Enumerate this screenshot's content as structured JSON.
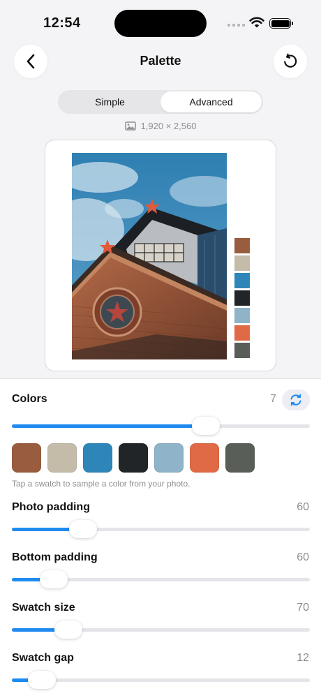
{
  "status_bar": {
    "time": "12:54"
  },
  "header": {
    "title": "Palette"
  },
  "segmented": {
    "options": [
      "Simple",
      "Advanced"
    ],
    "selected": "Advanced"
  },
  "image_info": {
    "dimensions": "1,920 × 2,560"
  },
  "palette_colors": [
    "#9a5c3e",
    "#c4bca9",
    "#2e86b8",
    "#222528",
    "#8fb3c8",
    "#e06a45",
    "#5a5e58"
  ],
  "colors_row": {
    "label": "Colors",
    "value": "7",
    "slider_fraction": 0.65
  },
  "hint": "Tap a swatch to sample a color from your photo.",
  "sliders": [
    {
      "label": "Photo padding",
      "value": "60",
      "fraction": 0.24
    },
    {
      "label": "Bottom padding",
      "value": "60",
      "fraction": 0.14
    },
    {
      "label": "Swatch size",
      "value": "70",
      "fraction": 0.19
    },
    {
      "label": "Swatch gap",
      "value": "12",
      "fraction": 0.1
    }
  ],
  "accent_color": "#1f8bf0"
}
